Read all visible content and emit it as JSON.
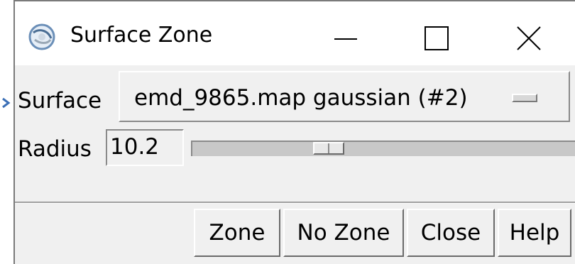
{
  "window": {
    "title": "Surface Zone",
    "app_icon": "chimera-app-icon",
    "controls": {
      "minimize": "minimize-icon",
      "maximize": "maximize-icon",
      "close": "close-icon"
    }
  },
  "surface": {
    "label": "Surface",
    "selected": "emd_9865.map gaussian (#2)"
  },
  "radius": {
    "label": "Radius",
    "value": "10.2",
    "slider_fraction": 0.33
  },
  "buttons": {
    "zone": "Zone",
    "no_zone": "No Zone",
    "close": "Close",
    "help": "Help"
  },
  "colors": {
    "dialog_bg": "#f0f0f0",
    "titlebar_bg": "#ffffff",
    "trough": "#c8c8c8",
    "arrow": "#3b6fb6"
  }
}
